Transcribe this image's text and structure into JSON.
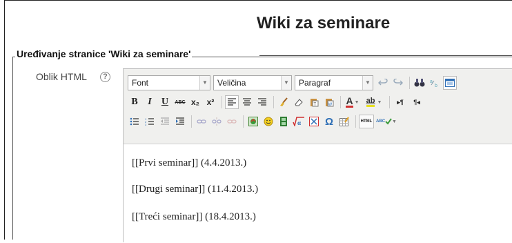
{
  "page": {
    "title": "Wiki za seminare"
  },
  "form": {
    "legend": "Uređivanje stranice 'Wiki za seminare'",
    "field_label": "Oblik HTML",
    "help_glyph": "?"
  },
  "toolbar": {
    "font_select": "Font",
    "size_select": "Veličina",
    "format_select": "Paragraf",
    "bold": "B",
    "italic": "I",
    "underline": "U",
    "strike": "ABC",
    "subscript": "x₂",
    "superscript": "x²",
    "font_color": "A",
    "highlight": "ab",
    "ltr": "▸¶",
    "rtl": "¶◂",
    "omega": "Ω",
    "html": "HTML",
    "spell": "ABC"
  },
  "content": {
    "lines": [
      "[[Prvi seminar]] (4.4.2013.)",
      "[[Drugi seminar]] (11.4.2013.)",
      "[[Treći seminar]] (18.4.2013.)"
    ]
  },
  "colors": {
    "link_icon": "#2f6fb6",
    "accent": "#d03030",
    "green": "#3a9a3a"
  }
}
